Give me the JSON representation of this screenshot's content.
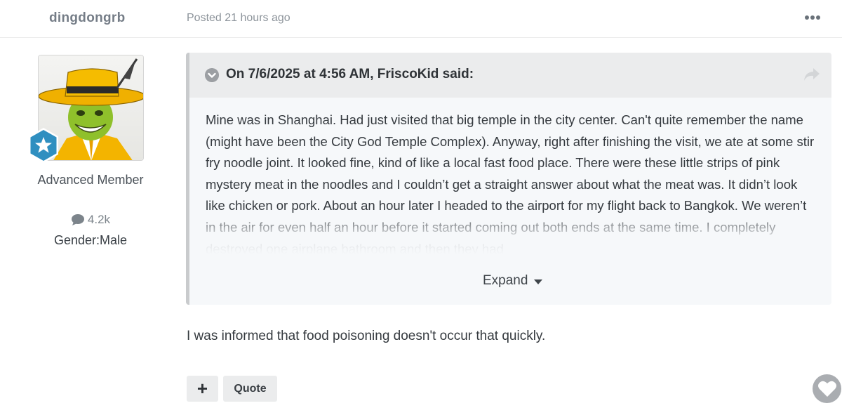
{
  "post": {
    "author": "dingdongrb",
    "posted": "Posted 21 hours ago",
    "menu_icon": "more-horizontal-icon"
  },
  "author_panel": {
    "member_title": "Advanced Member",
    "post_count": "4.2k",
    "gender": "Gender:Male",
    "badge_icon": "star-badge-icon",
    "count_icon": "comment-icon"
  },
  "quote": {
    "citation": "On 7/6/2025 at 4:56 AM, FriscoKid said:",
    "text": "Mine was in Shanghai. Had just visited that big temple in the city center. Can't quite remember the name (might have been the City God Temple Complex). Anyway, right after finishing the visit, we ate at some stir fry noodle joint. It looked fine, kind of like a local fast food place. There were these little strips of pink mystery meat in the noodles and I couldn’t get a straight answer about what the meat was. It didn’t look like chicken or pork. About an hour later I headed to the airport for my flight back to Bangkok. We weren’t in the air for even half an hour before it started coming out both ends at the same time. I completely destroyed one airplane bathroom and then they had",
    "expand_label": "Expand",
    "toggle_icon": "chevron-down-icon",
    "share_icon": "share-icon"
  },
  "body": {
    "text": "I was informed that food poisoning doesn't occur that quickly."
  },
  "actions": {
    "plus_label": "+",
    "quote_label": "Quote",
    "reaction_icon": "heart-icon"
  },
  "colors": {
    "quote_background": "#f6f8fa",
    "quote_header": "#ebeced",
    "quote_border": "#c9cbcd",
    "badge": "#2f8fc0",
    "avatar_hat": "#f4b400",
    "avatar_face": "#8fbf2a"
  }
}
